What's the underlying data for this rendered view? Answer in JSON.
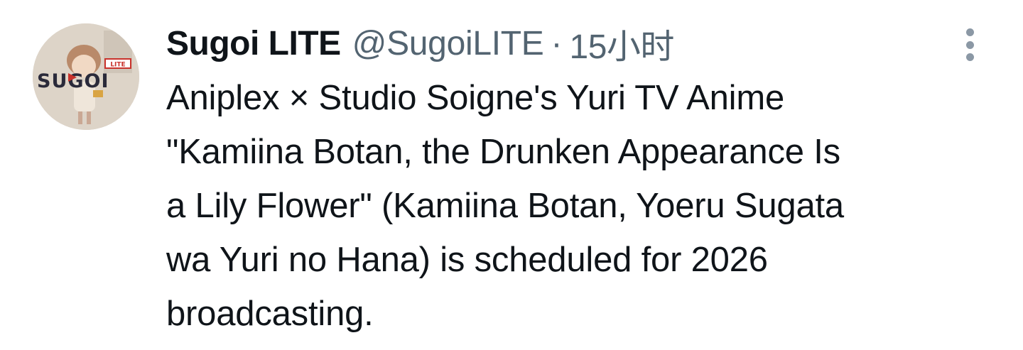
{
  "tweet": {
    "author": {
      "display_name": "Sugoi LITE",
      "handle": "@SugoiLITE",
      "avatar_text": "SUGOI",
      "avatar_badge": "LITE"
    },
    "separator": "·",
    "time": "15小时",
    "more_icon": "more-vertical-icon",
    "text_lines": [
      "Aniplex × Studio Soigne's Yuri TV Anime",
      "\"Kamiina Botan, the Drunken Appearance Is",
      "a Lily Flower\" (Kamiina Botan, Yoeru Sugata",
      "wa Yuri no Hana) is scheduled for 2026",
      "broadcasting."
    ]
  },
  "colors": {
    "primary_text": "#0f1419",
    "secondary_text": "#536471",
    "icon": "#8b98a5",
    "logo_red": "#c9332c",
    "logo_dark": "#2a2a3a"
  }
}
